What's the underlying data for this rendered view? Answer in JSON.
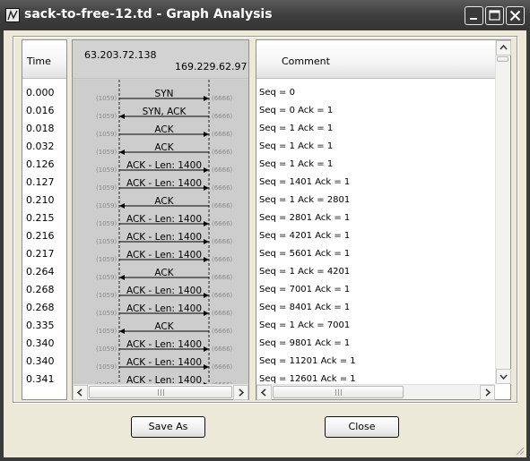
{
  "window": {
    "title": "sack-to-free-12.td - Graph Analysis"
  },
  "columns": {
    "time_header": "Time",
    "comment_header": "Comment"
  },
  "hosts": {
    "left": "63.203.72.138",
    "right": "169.229.62.97"
  },
  "ports": {
    "left": "(1059)",
    "right": "(6666)"
  },
  "rows": [
    {
      "time": "0.000",
      "label": "SYN",
      "dir": "right",
      "comment": "Seq = 0"
    },
    {
      "time": "0.016",
      "label": "SYN, ACK",
      "dir": "left",
      "comment": "Seq = 0 Ack = 1"
    },
    {
      "time": "0.018",
      "label": "ACK",
      "dir": "right",
      "comment": "Seq = 1 Ack = 1"
    },
    {
      "time": "0.032",
      "label": "ACK",
      "dir": "left",
      "comment": "Seq = 1 Ack = 1"
    },
    {
      "time": "0.126",
      "label": "ACK - Len: 1400",
      "dir": "right",
      "comment": "Seq = 1 Ack = 1"
    },
    {
      "time": "0.127",
      "label": "ACK - Len: 1400",
      "dir": "right",
      "comment": "Seq = 1401 Ack = 1"
    },
    {
      "time": "0.210",
      "label": "ACK",
      "dir": "left",
      "comment": "Seq = 1 Ack = 2801"
    },
    {
      "time": "0.215",
      "label": "ACK - Len: 1400",
      "dir": "right",
      "comment": "Seq = 2801 Ack = 1"
    },
    {
      "time": "0.216",
      "label": "ACK - Len: 1400",
      "dir": "right",
      "comment": "Seq = 4201 Ack = 1"
    },
    {
      "time": "0.217",
      "label": "ACK - Len: 1400",
      "dir": "right",
      "comment": "Seq = 5601 Ack = 1"
    },
    {
      "time": "0.264",
      "label": "ACK",
      "dir": "left",
      "comment": "Seq = 1 Ack = 4201"
    },
    {
      "time": "0.268",
      "label": "ACK - Len: 1400",
      "dir": "right",
      "comment": "Seq = 7001 Ack = 1"
    },
    {
      "time": "0.268",
      "label": "ACK - Len: 1400",
      "dir": "right",
      "comment": "Seq = 8401 Ack = 1"
    },
    {
      "time": "0.335",
      "label": "ACK",
      "dir": "left",
      "comment": "Seq = 1 Ack = 7001"
    },
    {
      "time": "0.340",
      "label": "ACK - Len: 1400",
      "dir": "right",
      "comment": "Seq = 9801 Ack = 1"
    },
    {
      "time": "0.340",
      "label": "ACK - Len: 1400",
      "dir": "right",
      "comment": "Seq = 11201 Ack = 1"
    },
    {
      "time": "0.341",
      "label": "ACK - Len: 1400",
      "dir": "right",
      "comment": "Seq = 12601 Ack = 1"
    }
  ],
  "buttons": {
    "save_as": "Save As",
    "close": "Close"
  },
  "icons": {
    "window": "graph-window-icon",
    "minimize": "minimize-icon",
    "maximize": "maximize-icon",
    "close": "close-icon"
  }
}
